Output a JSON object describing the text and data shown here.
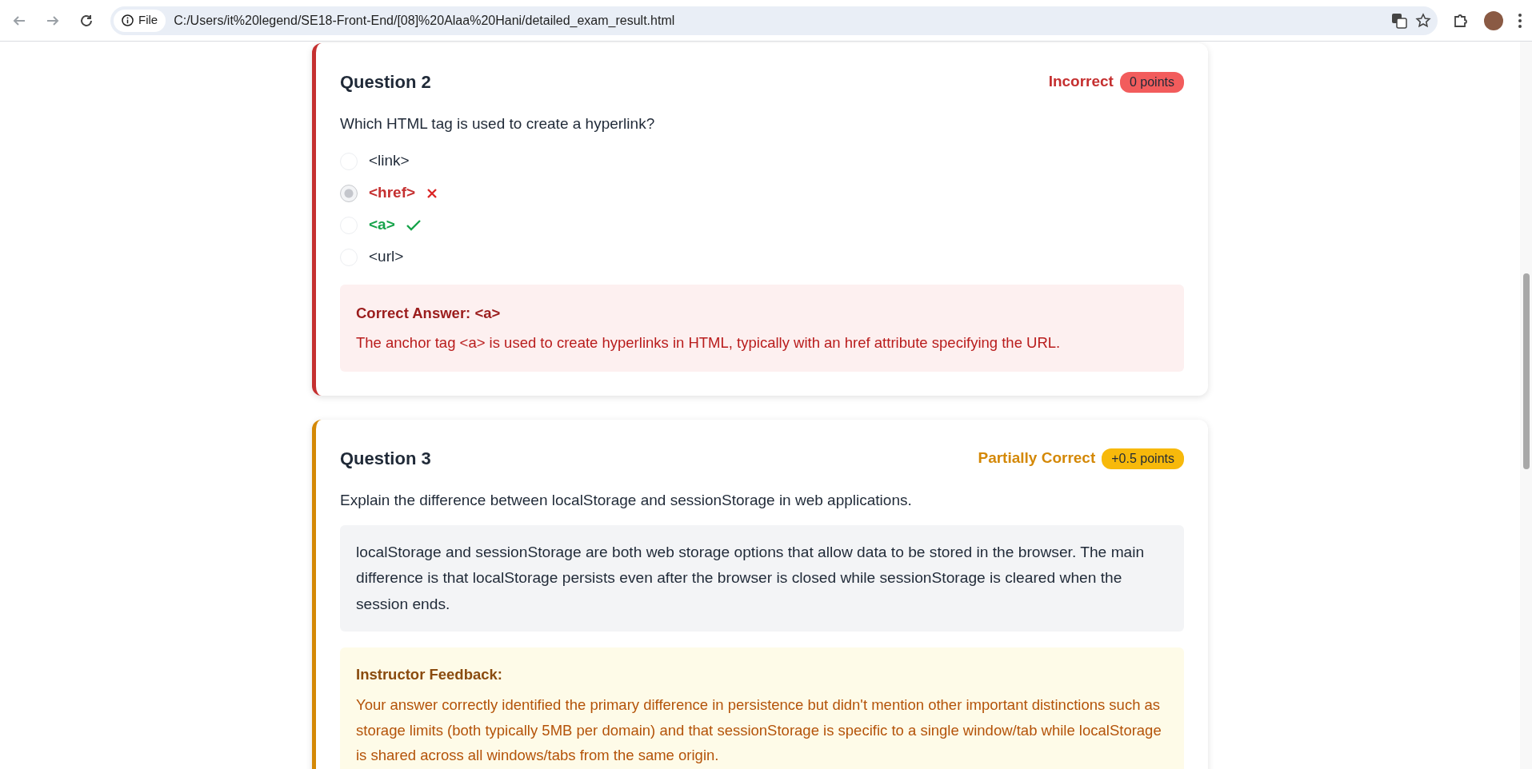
{
  "browser": {
    "site_chip": "File",
    "url": "C:/Users/it%20legend/SE18-Front-End/[08]%20Alaa%20Hani/detailed_exam_result.html"
  },
  "questions": [
    {
      "kind": "choice",
      "title": "Question 2",
      "status": "Incorrect",
      "color": "#c53030",
      "points": "0 points",
      "prompt": "Which HTML tag is used to create a hyperlink?",
      "options": [
        {
          "text": "<link>",
          "selected": false,
          "wrong": false,
          "right": false
        },
        {
          "text": "<href>",
          "selected": true,
          "wrong": true,
          "right": false
        },
        {
          "text": "<a>",
          "selected": false,
          "wrong": false,
          "right": true
        },
        {
          "text": "<url>",
          "selected": false,
          "wrong": false,
          "right": false
        }
      ],
      "explanation": {
        "title": "Correct Answer: <a>",
        "text": "The anchor tag <a> is used to create hyperlinks in HTML, typically with an href attribute specifying the URL."
      }
    },
    {
      "kind": "text",
      "title": "Question 3",
      "status": "Partially Correct",
      "color": "#d48806",
      "points": "+0.5 points",
      "prompt": "Explain the difference between localStorage and sessionStorage in web applications.",
      "answer": "localStorage and sessionStorage are both web storage options that allow data to be stored in the browser. The main difference is that localStorage persists even after the browser is closed while sessionStorage is cleared when the session ends.",
      "feedback": {
        "title": "Instructor Feedback:",
        "text": "Your answer correctly identified the primary difference in persistence but didn't mention other important distinctions such as storage limits (both typically 5MB per domain) and that sessionStorage is specific to a single window/tab while localStorage is shared across all windows/tabs from the same origin."
      }
    }
  ]
}
